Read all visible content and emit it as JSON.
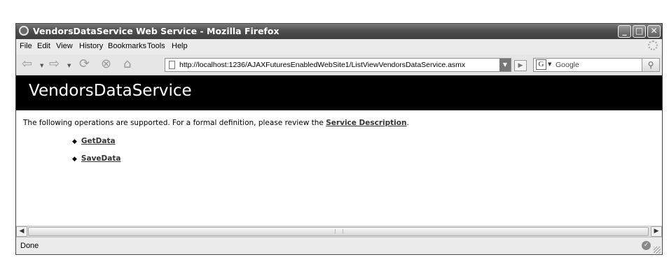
{
  "window": {
    "title": "VendorsDataService Web Service - Mozilla Firefox",
    "controls": {
      "minimize": "_",
      "maximize": "□",
      "close": "✕"
    }
  },
  "menubar": {
    "items": [
      {
        "label": "File"
      },
      {
        "label": "Edit"
      },
      {
        "label": "View"
      },
      {
        "label": "History"
      },
      {
        "label": "Bookmarks"
      },
      {
        "label": "Tools"
      },
      {
        "label": "Help"
      }
    ]
  },
  "navbar": {
    "url": "http://localhost:1236/AJAXFuturesEnabledWebSite1/ListViewVendorsDataService.asmx",
    "search_engine_icon": "G",
    "search_placeholder": "Google",
    "icons": {
      "back": "back-arrow-icon",
      "forward": "forward-arrow-icon",
      "reload": "reload-icon",
      "stop": "stop-icon",
      "home": "home-icon",
      "go": "go-arrow-icon",
      "search": "magnifier-icon"
    }
  },
  "page": {
    "heading": "VendorsDataService",
    "intro_text": "The following operations are supported. For a formal definition, please review the ",
    "intro_link": "Service Description",
    "intro_end": ".",
    "operations": [
      {
        "label": "GetData"
      },
      {
        "label": "SaveData"
      }
    ]
  },
  "status": {
    "text": "Done"
  },
  "colors": {
    "banner_bg": "#000000",
    "banner_text": "#ffffff",
    "titlebar": "#4e4e4e"
  }
}
